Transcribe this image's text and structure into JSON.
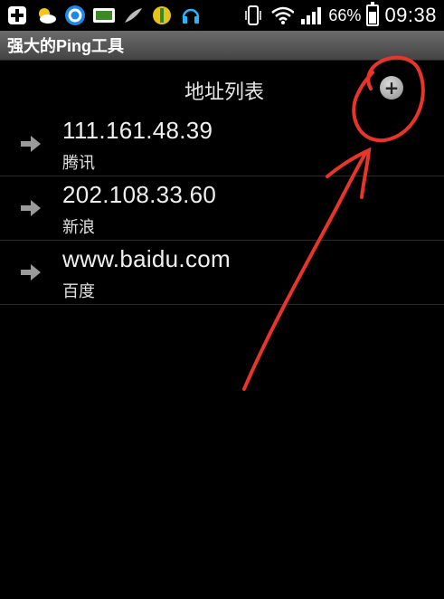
{
  "status_bar": {
    "icons": [
      "plus-square-icon",
      "weather-icon",
      "browser-icon",
      "sim-icon",
      "feather-icon",
      "gift-icon",
      "headset-icon"
    ],
    "battery_percent": "66%",
    "time": "09:38"
  },
  "app": {
    "title": "强大的Ping工具"
  },
  "header": {
    "title": "地址列表",
    "add_icon": "plus-circle-icon"
  },
  "addresses": [
    {
      "address": "111.161.48.39",
      "name": "腾讯"
    },
    {
      "address": "202.108.33.60",
      "name": "新浪"
    },
    {
      "address": "www.baidu.com",
      "name": "百度"
    }
  ],
  "colors": {
    "annotation": "#e8352b",
    "background": "#000000"
  }
}
